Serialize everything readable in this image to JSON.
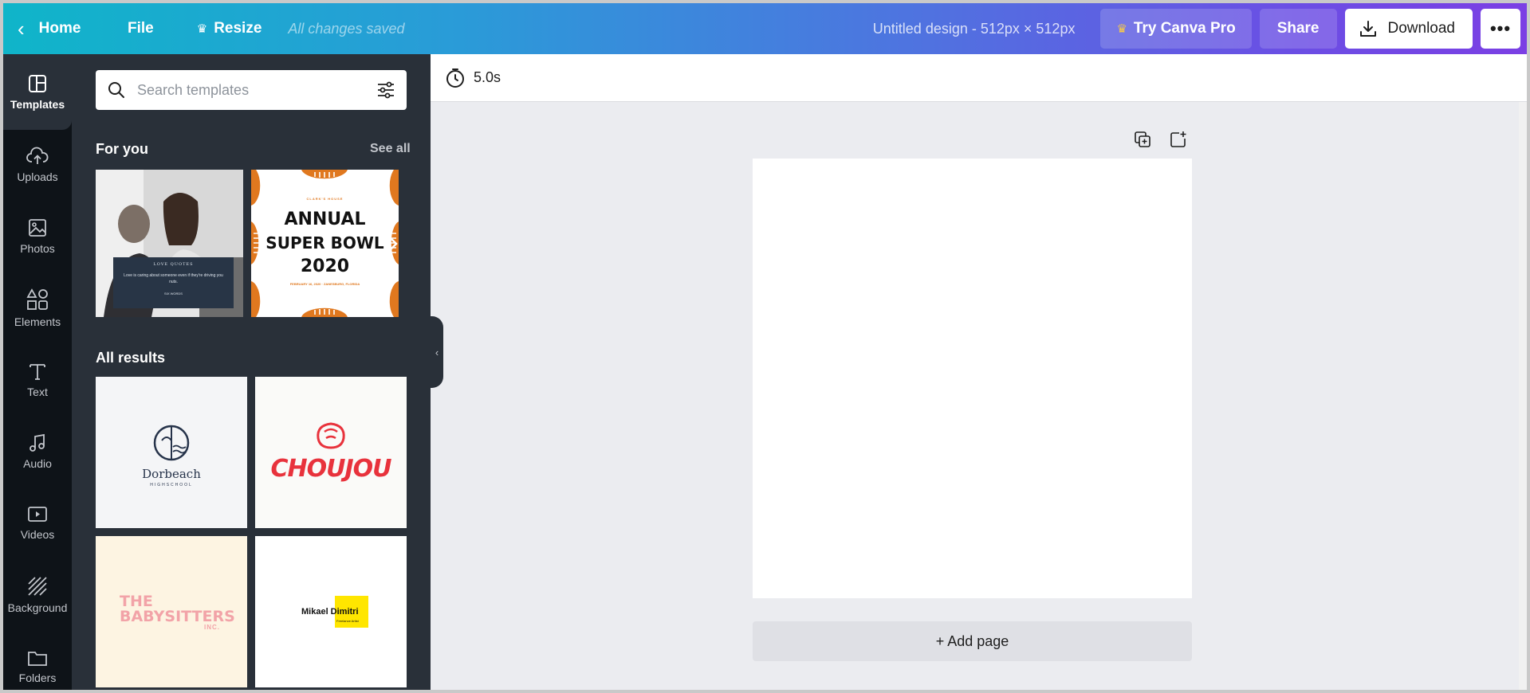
{
  "topbar": {
    "home": "Home",
    "file": "File",
    "resize": "Resize",
    "saved_status": "All changes saved",
    "title": "Untitled design - 512px × 512px",
    "try_pro": "Try Canva Pro",
    "share": "Share",
    "download": "Download",
    "more": "•••"
  },
  "rail": {
    "items": [
      {
        "label": "Templates",
        "icon": "templates-icon"
      },
      {
        "label": "Uploads",
        "icon": "upload-cloud-icon"
      },
      {
        "label": "Photos",
        "icon": "photo-icon"
      },
      {
        "label": "Elements",
        "icon": "shapes-icon"
      },
      {
        "label": "Text",
        "icon": "text-icon"
      },
      {
        "label": "Audio",
        "icon": "music-note-icon"
      },
      {
        "label": "Videos",
        "icon": "video-icon"
      },
      {
        "label": "Background",
        "icon": "background-pattern-icon"
      },
      {
        "label": "Folders",
        "icon": "folder-icon"
      }
    ]
  },
  "panel": {
    "search_placeholder": "Search templates",
    "for_you_title": "For you",
    "see_all": "See all",
    "all_results_title": "All results",
    "for_you": [
      {
        "kind": "love-quotes",
        "heading": "LOVE QUOTES",
        "quote": "Love is caring about someone even if they're driving you nuts.",
        "author": "SIX WORDS"
      },
      {
        "kind": "super-bowl",
        "kicker": "CLARK'S HOUSE",
        "headline": [
          "ANNUAL",
          "SUPER BOWL",
          "2020"
        ],
        "detail": "FEBRUARY 16, 2020 · ZANESBURG, FLORIDA"
      }
    ],
    "results": [
      {
        "kind": "dorbeach",
        "name": "Dorbeach",
        "sub": "HIGHSCHOOL"
      },
      {
        "kind": "choujou",
        "name": "CHOUJOU"
      },
      {
        "kind": "babysitters",
        "name": "THE BABYSITTERS",
        "sub": "INC."
      },
      {
        "kind": "mikael",
        "name": "Mikael Dimitri",
        "sub": "Freelance Artist"
      }
    ]
  },
  "editor": {
    "duration": "5.0s",
    "add_page": "+ Add page"
  },
  "colors": {
    "gradient_start": "#0fb5c9",
    "gradient_end": "#7b3fe4",
    "rail_bg": "#0e1318",
    "panel_bg": "#293039",
    "choujou_red": "#e8323c",
    "babysitters_pink": "#f2a3a8",
    "mikael_yellow": "#ffe600",
    "football_orange": "#e0781f"
  }
}
